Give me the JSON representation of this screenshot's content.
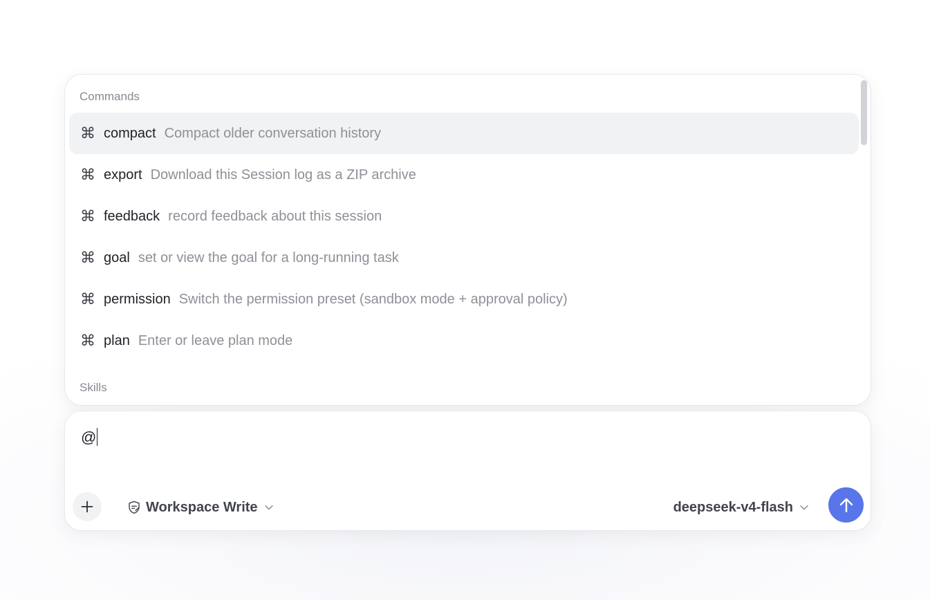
{
  "popup": {
    "commands_header": "Commands",
    "skills_header": "Skills",
    "commands": [
      {
        "icon": "command-icon",
        "glyph": "⌘",
        "name": "compact",
        "description": "Compact older conversation history",
        "selected": true
      },
      {
        "icon": "command-icon",
        "glyph": "⌘",
        "name": "export",
        "description": "Download this Session log as a ZIP archive",
        "selected": false
      },
      {
        "icon": "command-icon",
        "glyph": "⌘",
        "name": "feedback",
        "description": "record feedback about this session",
        "selected": false
      },
      {
        "icon": "command-icon",
        "glyph": "⌘",
        "name": "goal",
        "description": "set or view the goal for a long-running task",
        "selected": false
      },
      {
        "icon": "command-icon",
        "glyph": "⌘",
        "name": "permission",
        "description": "Switch the permission preset (sandbox mode + approval policy)",
        "selected": false
      },
      {
        "icon": "command-icon",
        "glyph": "⌘",
        "name": "plan",
        "description": "Enter or leave plan mode",
        "selected": false
      }
    ]
  },
  "composer": {
    "input_value": "@",
    "add_icon": "plus-icon",
    "permission": {
      "icon": "shield-icon",
      "label": "Workspace Write",
      "dropdown_icon": "chevron-down-icon"
    },
    "model": {
      "label": "deepseek-v4-flash",
      "dropdown_icon": "chevron-down-icon"
    },
    "send_icon": "arrow-up-icon"
  },
  "colors": {
    "accent": "#5876ea",
    "selected_row": "#f1f2f4",
    "muted_text": "#8e9098",
    "primary_text": "#1f2127"
  }
}
